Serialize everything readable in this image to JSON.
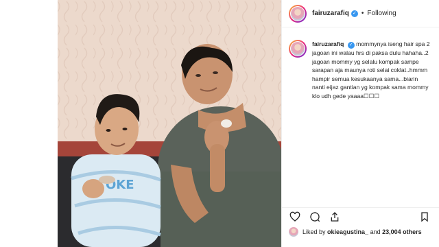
{
  "post": {
    "username": "fairuzarafiq",
    "follow_status": "Following",
    "separator": "•"
  },
  "caption": {
    "username": "fairuzarafiq",
    "text": "mommynya iseng hair spa 2 jagoan ini walau hrs di paksa dulu hahaha..2 jagoan mommy yg selalu kompak sampe sarapan aja maunya roti selai coklat..hmmm hampir semua kesukaanya sama...biarin nanti eijaz gantian yg kompak sama mommy klo udh gede yaaaa☐☐☐"
  },
  "likes": {
    "prefix": "Liked by",
    "first_user": "okieagustina_",
    "middle": "and",
    "count_text": "23,004 others"
  },
  "icons": {
    "verified": "verified-badge-icon",
    "like": "heart-icon",
    "comment": "comment-icon",
    "share": "share-icon",
    "save": "bookmark-icon"
  },
  "colors": {
    "verified": "#3897f0",
    "text": "#262626",
    "border": "#efefef"
  }
}
